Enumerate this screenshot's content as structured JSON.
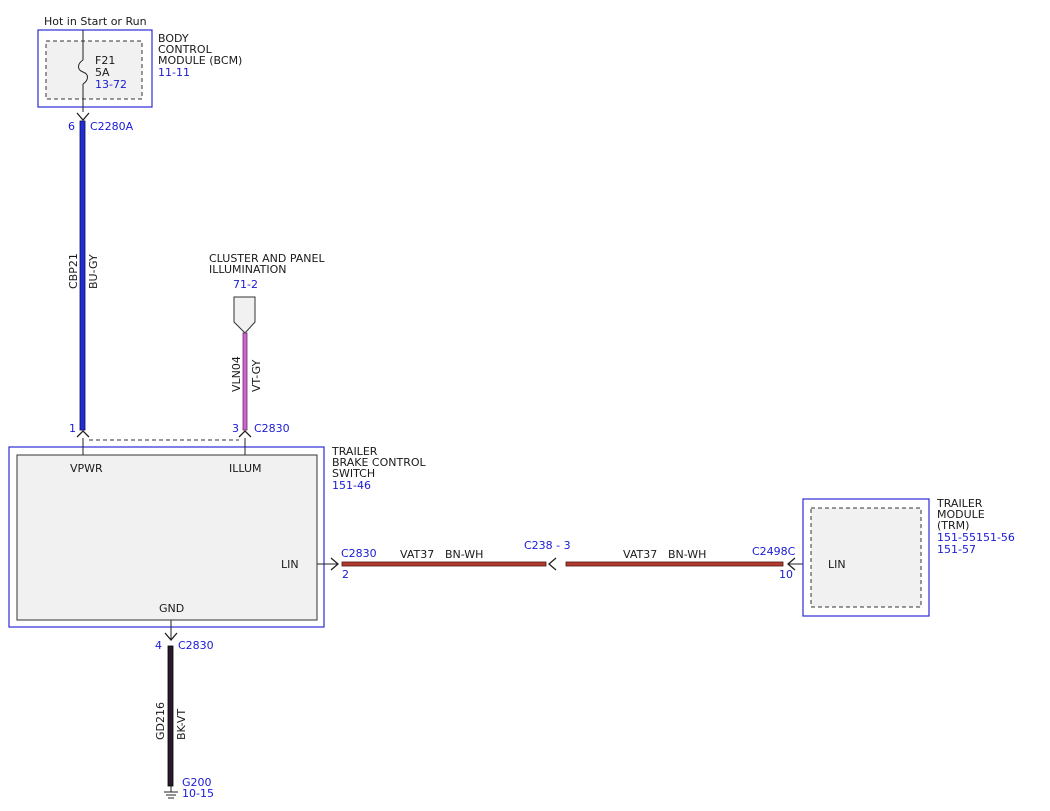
{
  "power_label": "Hot in Start or Run",
  "bcm": {
    "name_lines": [
      "BODY",
      "CONTROL",
      "MODULE (BCM)"
    ],
    "ref": "11-11",
    "fuse": {
      "id": "F21",
      "rating": "5A",
      "ref": "13-72"
    },
    "pin": "6",
    "connector": "C2280A"
  },
  "wire_cbp21": {
    "circuit": "CBP21",
    "color_code": "BU-GY",
    "color": "#1f2fd0"
  },
  "illumination": {
    "name_lines": [
      "CLUSTER AND PANEL",
      "ILLUMINATION"
    ],
    "ref": "71-2"
  },
  "wire_vln04": {
    "circuit": "VLN04",
    "color_code": "VT-GY",
    "color": "#cc66cc"
  },
  "tbcs": {
    "name_lines": [
      "TRAILER",
      "BRAKE CONTROL",
      "SWITCH"
    ],
    "ref": "151-46",
    "pin_vpwr": "1",
    "pin_illum": "3",
    "connector_top": "C2830",
    "label_vpwr": "VPWR",
    "label_illum": "ILLUM",
    "label_lin": "LIN",
    "label_gnd": "GND",
    "connector_lin": "C2830",
    "pin_lin": "2",
    "pin_gnd": "4",
    "connector_gnd": "C2830"
  },
  "wire_vat37": {
    "circuit": "VAT37",
    "color_code": "BN-WH",
    "color": "#b33a2c",
    "inline_connector": "C238 - 3"
  },
  "trm": {
    "name_lines": [
      "TRAILER",
      "MODULE",
      "(TRM)"
    ],
    "refs": [
      "151-55151-56",
      "151-57"
    ],
    "connector": "C2498C",
    "pin": "10",
    "label_lin": "LIN"
  },
  "wire_gd216": {
    "circuit": "GD216",
    "color_code": "BK-VT",
    "color": "#2a1a2e"
  },
  "ground": {
    "id": "G200",
    "ref": "10-15"
  }
}
